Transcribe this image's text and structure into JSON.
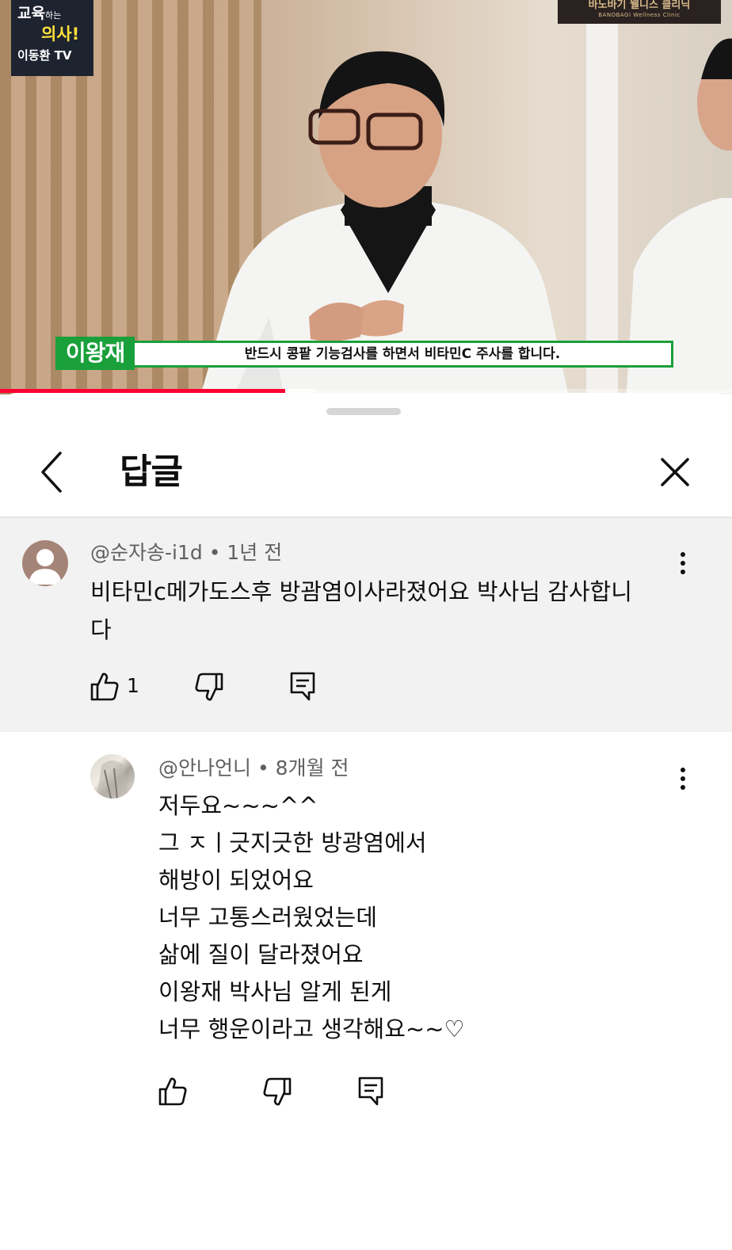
{
  "video": {
    "channel_logo": {
      "line1": "교육",
      "line1_small": "하는",
      "line2": "의사!",
      "line3": "이동환 TV"
    },
    "clinic_logo": {
      "name": "바노바기 웰니스 클리닉",
      "sub": "BANOBAGI Wellness Clinic"
    },
    "caption": {
      "speaker": "이왕재",
      "text": "반드시 콩팥 기능검사를 하면서 비타민C 주사를 합니다."
    },
    "progress": {
      "played_fraction": 0.39,
      "buffered_fraction": 0.43
    }
  },
  "sheet": {
    "title": "답글",
    "back_icon": "chevron-left-icon",
    "close_icon": "close-icon"
  },
  "parent_comment": {
    "author": "@순자송-i1d",
    "time": "1년 전",
    "text_line1": "비타민c메가도스후 방괌염이사라졌어요 박사님 감사합니",
    "text_line2": "다",
    "like_count": "1"
  },
  "reply": {
    "author": "@안나언니",
    "time": "8개월 전",
    "lines": [
      "저두요~~~^^",
      "그  ㅈㅣ긋지긋한 방광염에서",
      "해방이 되었어요",
      "너무 고통스러웠었는데",
      "삶에 질이 달라졌어요",
      "이왕재 박사님 알게 된게",
      "너무 행운이라고 생각해요~~♡"
    ]
  },
  "colors": {
    "accent_red": "#ff0033",
    "caption_green": "#19a03a",
    "comment_bg": "#f2f2f2"
  }
}
